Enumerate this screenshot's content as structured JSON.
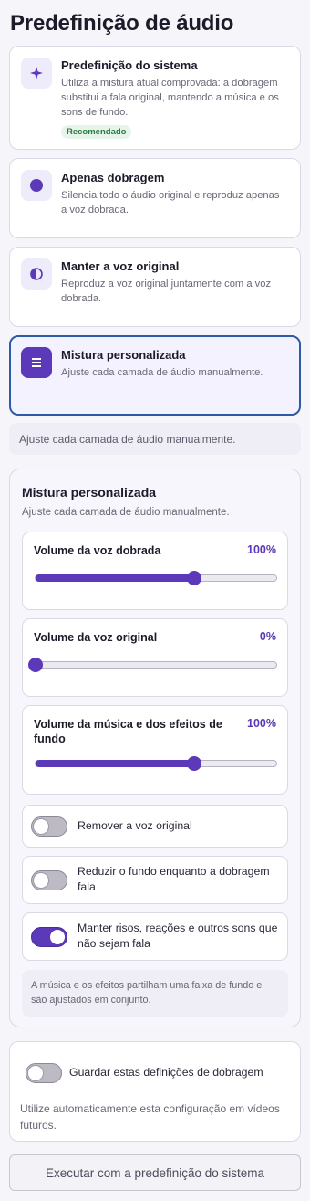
{
  "page": {
    "title": "Predefinição de áudio"
  },
  "presets": [
    {
      "icon": "sparkle-icon",
      "title": "Predefinição do sistema",
      "description": "Utiliza a mistura atual comprovada: a dobragem substitui a fala original, mantendo a música e os sons de fundo.",
      "badge": "Recomendado"
    },
    {
      "icon": "dot-icon",
      "title": "Apenas dobragem",
      "description": "Silencia todo o áudio original e reproduz apenas a voz dobrada."
    },
    {
      "icon": "half-circle-icon",
      "title": "Manter a voz original",
      "description": "Reproduz a voz original juntamente com a voz dobrada."
    },
    {
      "icon": "sliders-icon",
      "title": "Mistura personalizada",
      "description": "Ajuste cada camada de áudio manualmente.",
      "selected": true
    }
  ],
  "selected_note": "Ajuste cada camada de áudio manualmente.",
  "custom_mix": {
    "title": "Mistura personalizada",
    "description": "Ajuste cada camada de áudio manualmente.",
    "sliders": [
      {
        "label": "Volume da voz dobrada",
        "value_text": "100%",
        "level": 0.66
      },
      {
        "label": "Volume da voz original",
        "value_text": "0%",
        "level": 0.0
      },
      {
        "label": "Volume da música e dos efeitos de fundo",
        "value_text": "100%",
        "level": 0.66
      }
    ],
    "toggles": [
      {
        "label": "Remover a voz original",
        "on": false
      },
      {
        "label": "Reduzir o fundo enquanto a dobragem fala",
        "on": false
      },
      {
        "label": "Manter risos, reações e outros sons que não sejam fala",
        "on": true
      }
    ],
    "info": "A música e os efeitos partilham uma faixa de fundo e são ajustados em conjunto."
  },
  "save": {
    "label": "Guardar estas definições de dobragem",
    "on": false,
    "description": "Utilize automaticamente esta configuração em vídeos futuros."
  },
  "run_button": "Executar com a predefinição do sistema",
  "colors": {
    "accent": "#5b39b8",
    "selected_border": "#2f5aa6",
    "badge_bg": "#e6f4ea",
    "badge_text": "#2d7a45"
  }
}
